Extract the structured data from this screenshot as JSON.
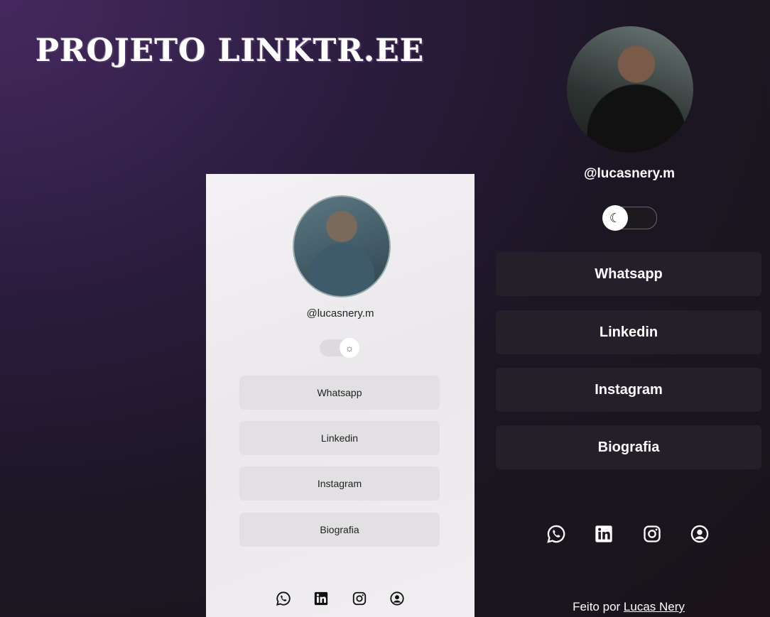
{
  "header": {
    "title": "PROJETO LINKTR.EE"
  },
  "light_preview": {
    "handle": "@lucasnery.m",
    "theme_icon": "sun-icon",
    "buttons": [
      "Whatsapp",
      "Linkedin",
      "Instagram",
      "Biografia"
    ],
    "social_icons": [
      "whatsapp-icon",
      "linkedin-icon",
      "instagram-icon",
      "user-circle-icon"
    ]
  },
  "profile": {
    "handle": "@lucasnery.m",
    "theme_icon": "moon-icon",
    "buttons": [
      "Whatsapp",
      "Linkedin",
      "Instagram",
      "Biografia"
    ],
    "social_icons": [
      "whatsapp-icon",
      "linkedin-icon",
      "instagram-icon",
      "user-circle-icon"
    ]
  },
  "footer": {
    "prefix": "Feito por",
    "author": "Lucas Nery"
  },
  "colors": {
    "button_dark": "#251f29",
    "button_light": "#e2e0e3",
    "accent": "#ffffff"
  }
}
